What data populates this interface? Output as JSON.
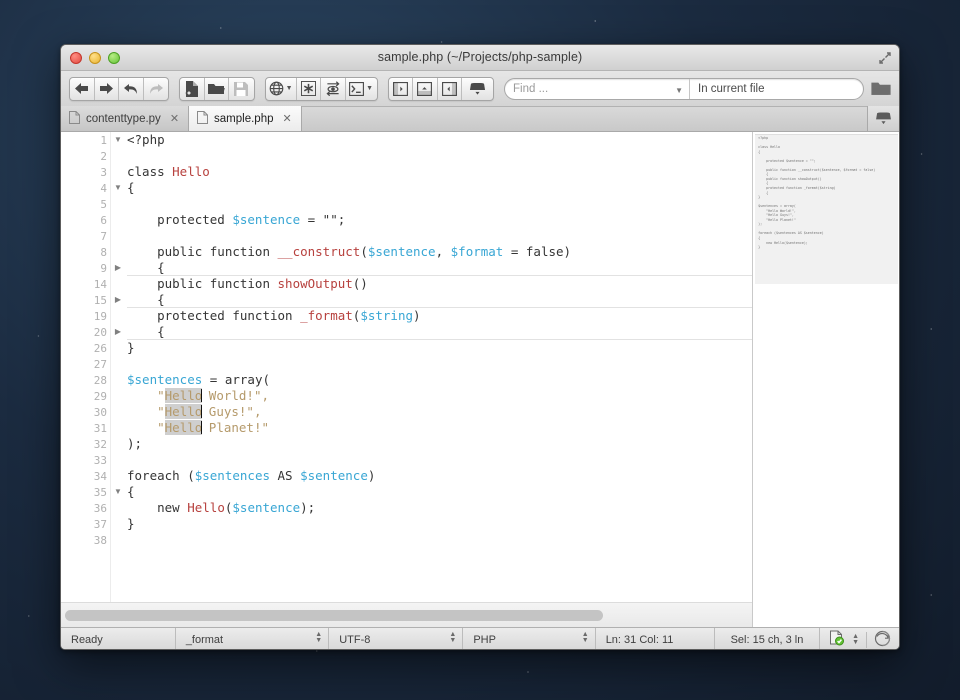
{
  "window": {
    "title": "sample.php (~/Projects/php-sample)",
    "traffic_lights": [
      "close",
      "minimize",
      "zoom"
    ],
    "resize_icon": "resize-diagonal-icon"
  },
  "toolbar": {
    "nav_group": [
      {
        "name": "back-button",
        "icon": "arrow-left-icon",
        "enabled": true
      },
      {
        "name": "forward-button",
        "icon": "arrow-right-icon",
        "enabled": true
      },
      {
        "name": "undo-button",
        "icon": "undo-arrow-icon",
        "enabled": true
      },
      {
        "name": "redo-button",
        "icon": "redo-arrow-icon",
        "enabled": false
      }
    ],
    "file_group": [
      {
        "name": "new-file-button",
        "icon": "new-document-icon",
        "enabled": true
      },
      {
        "name": "open-folder-button",
        "icon": "folder-open-icon",
        "enabled": true
      },
      {
        "name": "save-button",
        "icon": "floppy-disk-icon",
        "enabled": false
      }
    ],
    "tools_group": [
      {
        "name": "preview-in-browser-button",
        "icon": "globe-icon",
        "dropdown": true
      },
      {
        "name": "syntax-check-button",
        "icon": "asterisk-icon",
        "dropdown": false
      },
      {
        "name": "goto-definition-button",
        "icon": "eye-arrow-icon",
        "dropdown": false
      },
      {
        "name": "terminal-button",
        "icon": "terminal-icon",
        "dropdown": true
      }
    ],
    "panel_group": [
      {
        "name": "toggle-left-panel-button",
        "icon": "panel-left-icon"
      },
      {
        "name": "toggle-bottom-panel-button",
        "icon": "panel-bottom-icon"
      },
      {
        "name": "toggle-right-panel-button",
        "icon": "panel-right-icon"
      },
      {
        "name": "toggle-top-panel-button",
        "icon": "panel-top-icon"
      }
    ]
  },
  "find": {
    "query_value": "",
    "query_placeholder": "Find ...",
    "scope_value": "In current file",
    "scope_placeholder": "In current file",
    "browse_icon": "folder-icon"
  },
  "tabs": {
    "items": [
      {
        "label": "contenttype.py",
        "active": false,
        "close_icon": "close-icon"
      },
      {
        "label": "sample.php",
        "active": true,
        "close_icon": "close-icon"
      }
    ],
    "right_button_icon": "panel-top-icon"
  },
  "editor": {
    "language": "PHP",
    "lines": [
      {
        "num": "1",
        "fold": "down",
        "folded": false,
        "tokens": [
          {
            "t": "<?php",
            "c": "kw"
          }
        ]
      },
      {
        "num": "2",
        "fold": "",
        "folded": false,
        "tokens": []
      },
      {
        "num": "3",
        "fold": "",
        "folded": false,
        "tokens": [
          {
            "t": "class ",
            "c": "kw"
          },
          {
            "t": "Hello",
            "c": "cls"
          }
        ]
      },
      {
        "num": "4",
        "fold": "down",
        "folded": false,
        "tokens": [
          {
            "t": "{",
            "c": "kw"
          }
        ]
      },
      {
        "num": "5",
        "fold": "",
        "folded": false,
        "tokens": []
      },
      {
        "num": "6",
        "fold": "",
        "folded": false,
        "tokens": [
          {
            "t": "    protected ",
            "c": "kw"
          },
          {
            "t": "$sentence",
            "c": "var"
          },
          {
            "t": " = \"\";",
            "c": "kw"
          }
        ]
      },
      {
        "num": "7",
        "fold": "",
        "folded": false,
        "tokens": []
      },
      {
        "num": "8",
        "fold": "",
        "folded": false,
        "tokens": [
          {
            "t": "    public function ",
            "c": "kw"
          },
          {
            "t": "__construct",
            "c": "fn"
          },
          {
            "t": "(",
            "c": "kw"
          },
          {
            "t": "$sentence",
            "c": "var"
          },
          {
            "t": ", ",
            "c": "kw"
          },
          {
            "t": "$format",
            "c": "var"
          },
          {
            "t": " = false)",
            "c": "kw"
          }
        ]
      },
      {
        "num": "9",
        "fold": "right",
        "folded": true,
        "tokens": [
          {
            "t": "    {",
            "c": "kw"
          }
        ]
      },
      {
        "num": "14",
        "fold": "",
        "folded": false,
        "tokens": [
          {
            "t": "    public function ",
            "c": "kw"
          },
          {
            "t": "showOutput",
            "c": "fn"
          },
          {
            "t": "()",
            "c": "kw"
          }
        ]
      },
      {
        "num": "15",
        "fold": "right",
        "folded": true,
        "tokens": [
          {
            "t": "    {",
            "c": "kw"
          }
        ]
      },
      {
        "num": "19",
        "fold": "",
        "folded": false,
        "tokens": [
          {
            "t": "    protected function ",
            "c": "kw"
          },
          {
            "t": "_format",
            "c": "fn"
          },
          {
            "t": "(",
            "c": "kw"
          },
          {
            "t": "$string",
            "c": "var"
          },
          {
            "t": ")",
            "c": "kw"
          }
        ]
      },
      {
        "num": "20",
        "fold": "right",
        "folded": true,
        "tokens": [
          {
            "t": "    {",
            "c": "kw"
          }
        ]
      },
      {
        "num": "26",
        "fold": "",
        "folded": false,
        "tokens": [
          {
            "t": "}",
            "c": "kw"
          }
        ]
      },
      {
        "num": "27",
        "fold": "",
        "folded": false,
        "tokens": []
      },
      {
        "num": "28",
        "fold": "",
        "folded": false,
        "tokens": [
          {
            "t": "$sentences",
            "c": "var"
          },
          {
            "t": " = array(",
            "c": "kw"
          }
        ]
      },
      {
        "num": "29",
        "fold": "",
        "folded": false,
        "tokens": [
          {
            "t": "    \"",
            "c": "str"
          },
          {
            "t": "Hello",
            "c": "str sel"
          },
          {
            "t": "│",
            "c": "cursor"
          },
          {
            "t": " World!\",",
            "c": "str"
          }
        ]
      },
      {
        "num": "30",
        "fold": "",
        "folded": false,
        "tokens": [
          {
            "t": "    \"",
            "c": "str"
          },
          {
            "t": "Hello",
            "c": "str sel"
          },
          {
            "t": "│",
            "c": "cursor"
          },
          {
            "t": " Guys!\",",
            "c": "str"
          }
        ]
      },
      {
        "num": "31",
        "fold": "",
        "folded": false,
        "tokens": [
          {
            "t": "    \"",
            "c": "str"
          },
          {
            "t": "Hello",
            "c": "str sel"
          },
          {
            "t": "│",
            "c": "cursor"
          },
          {
            "t": " Planet!\"",
            "c": "str"
          }
        ]
      },
      {
        "num": "32",
        "fold": "",
        "folded": false,
        "tokens": [
          {
            "t": ");",
            "c": "kw"
          }
        ]
      },
      {
        "num": "33",
        "fold": "",
        "folded": false,
        "tokens": []
      },
      {
        "num": "34",
        "fold": "",
        "folded": false,
        "tokens": [
          {
            "t": "foreach (",
            "c": "kw"
          },
          {
            "t": "$sentences",
            "c": "var"
          },
          {
            "t": " AS ",
            "c": "kw"
          },
          {
            "t": "$sentence",
            "c": "var"
          },
          {
            "t": ")",
            "c": "kw"
          }
        ]
      },
      {
        "num": "35",
        "fold": "down",
        "folded": false,
        "tokens": [
          {
            "t": "{",
            "c": "kw"
          }
        ]
      },
      {
        "num": "36",
        "fold": "",
        "folded": false,
        "tokens": [
          {
            "t": "    new ",
            "c": "kw"
          },
          {
            "t": "Hello",
            "c": "cls"
          },
          {
            "t": "(",
            "c": "kw"
          },
          {
            "t": "$sentence",
            "c": "var"
          },
          {
            "t": ");",
            "c": "kw"
          }
        ]
      },
      {
        "num": "37",
        "fold": "",
        "folded": false,
        "tokens": [
          {
            "t": "}",
            "c": "kw"
          }
        ]
      },
      {
        "num": "38",
        "fold": "",
        "folded": false,
        "tokens": []
      }
    ],
    "minimap_text": "<?php\n\nclass Hello\n{\n\n    protected $sentence = \"\";\n\n    public function __construct($sentence, $format = false)\n    {\n    public function showOutput()\n    {\n    protected function _format($string)\n    {\n}\n\n$sentences = array(\n    \"Hello World!\",\n    \"Hello Guys!\",\n    \"Hello Planet!\"\n);\n\nforeach ($sentences AS $sentence)\n{\n    new Hello($sentence);\n}"
  },
  "status": {
    "state": "Ready",
    "symbol": "_format",
    "encoding": "UTF-8",
    "syntax": "PHP",
    "position": "Ln: 31 Col: 11",
    "selection": "Sel: 15 ch, 3 ln",
    "validate_icon": "document-check-icon",
    "sync_icon": "sync-circle-icon"
  },
  "colors": {
    "variable": "#38a6d4",
    "function": "#b7413e",
    "string": "#b59a6b",
    "text": "#353535",
    "selection": "#cfcfcf"
  }
}
